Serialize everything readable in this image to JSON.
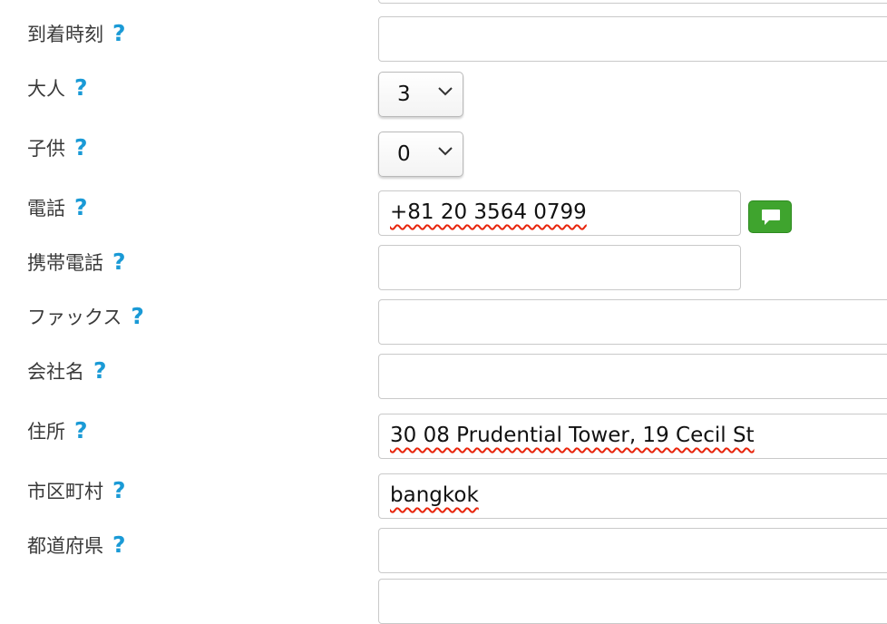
{
  "form": {
    "help_symbol": "?",
    "arrival_time": {
      "label": "到着時刻",
      "value": ""
    },
    "adults": {
      "label": "大人",
      "value": "3"
    },
    "children": {
      "label": "子供",
      "value": "0"
    },
    "phone": {
      "label": "電話",
      "value": "+81 20 3564 0799"
    },
    "mobile": {
      "label": "携帯電話",
      "value": ""
    },
    "fax": {
      "label": "ファックス",
      "value": ""
    },
    "company": {
      "label": "会社名",
      "value": ""
    },
    "address": {
      "label": "住所",
      "value": "30 08 Prudential Tower, 19 Cecil St"
    },
    "city": {
      "label": "市区町村",
      "value": "bangkok"
    },
    "prefecture": {
      "label": "都道府県",
      "value": ""
    }
  },
  "icons": {
    "help": "question-mark-icon",
    "dropdown": "chevron-down-icon",
    "sms": "speech-bubble-icon"
  },
  "colors": {
    "help": "#1a9ad6",
    "sms_button": "#3fa42e",
    "spellcheck": "#e8250c"
  }
}
